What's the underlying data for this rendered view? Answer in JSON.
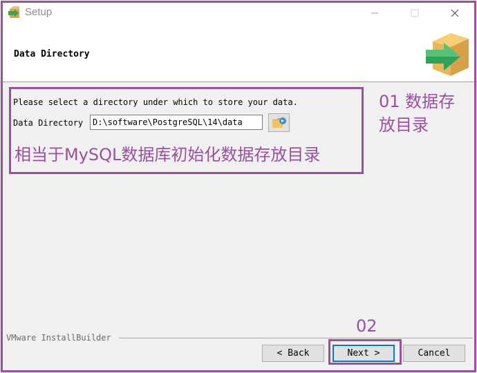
{
  "window": {
    "title": "Setup",
    "app_icon": "setup-arrow-box-icon"
  },
  "header": {
    "title": "Data Directory",
    "icon": "installer-box-arrow-icon"
  },
  "main": {
    "prompt": "Please select a directory under which to store your data.",
    "dir_label": "Data Directory",
    "dir_value": "D:\\software\\PostgreSQL\\14\\data",
    "browse_icon": "folder-browse-icon"
  },
  "footer": {
    "brand": "VMware InstallBuilder",
    "back_label": "< Back",
    "next_label": "Next >",
    "cancel_label": "Cancel"
  },
  "annotations": {
    "note_01": "01 数据存\n放目录",
    "note_main": "相当于MySQL数据库初始化数据存放目录",
    "note_02": "02",
    "color": "#9b4f9f"
  }
}
